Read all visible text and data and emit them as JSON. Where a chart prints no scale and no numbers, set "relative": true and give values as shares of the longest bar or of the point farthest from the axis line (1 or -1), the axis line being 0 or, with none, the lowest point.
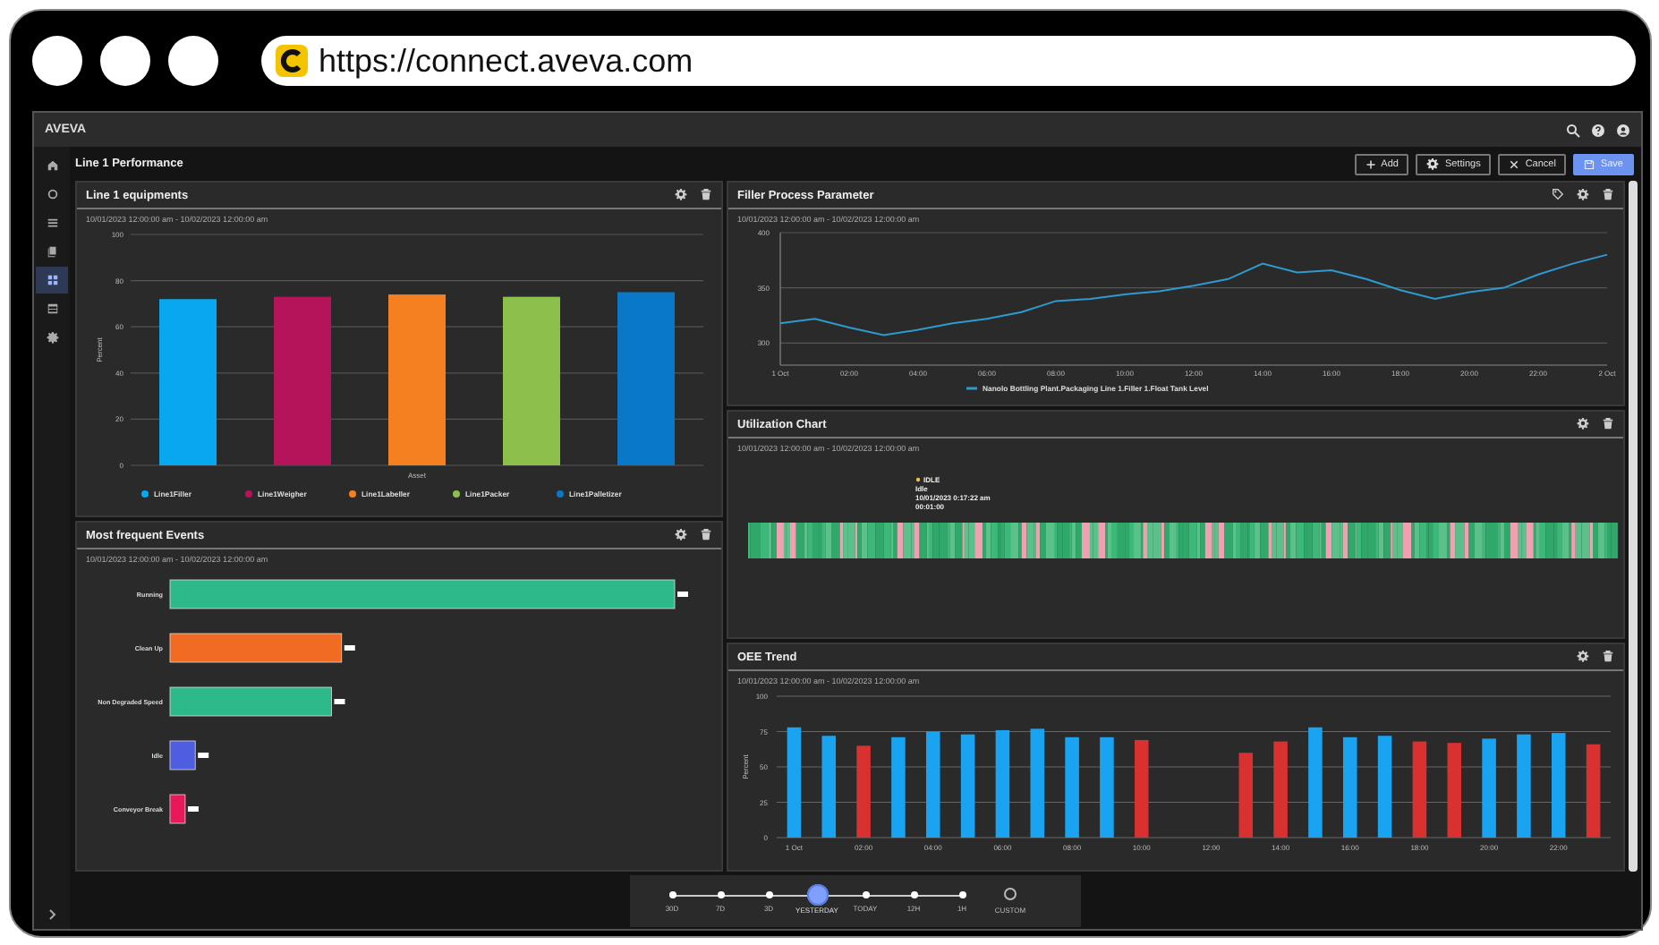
{
  "browser": {
    "url": "https://connect.aveva.com"
  },
  "app": {
    "brand": "AVEVA"
  },
  "sidebar": [
    {
      "kind": "home",
      "selected": false
    },
    {
      "kind": "gauge",
      "selected": false
    },
    {
      "kind": "list",
      "selected": false
    },
    {
      "kind": "copy",
      "selected": false
    },
    {
      "kind": "dashboard",
      "selected": true
    },
    {
      "kind": "table",
      "selected": false
    },
    {
      "kind": "settings",
      "selected": false
    }
  ],
  "page": {
    "title": "Line 1 Performance",
    "buttons": [
      {
        "kind": "add",
        "label": "Add",
        "primary": false
      },
      {
        "kind": "settings",
        "label": "Settings",
        "primary": false
      },
      {
        "kind": "cancel",
        "label": "Cancel",
        "primary": false
      },
      {
        "kind": "save",
        "label": "Save",
        "primary": true
      }
    ]
  },
  "line1_equipments": {
    "title": "Line 1 equipments",
    "date_range": "10/01/2023 12:00:00 am - 10/02/2023 12:00:00 am",
    "tag_button": false,
    "chart_data": {
      "type": "bar",
      "xlabel": "Asset",
      "ylabel": "Percent",
      "grid": true,
      "legend": "bottom",
      "ylim": [
        0,
        100
      ],
      "yticks": [
        0,
        20,
        40,
        60,
        80,
        100
      ],
      "series": [
        {
          "name": "Line1Filler",
          "color": "#08a8f0",
          "values": [
            72,
            null,
            null,
            null,
            null
          ]
        },
        {
          "name": "Line1Weigher",
          "color": "#b5145a",
          "values": [
            null,
            73,
            null,
            null,
            null
          ]
        },
        {
          "name": "Line1Labeller",
          "color": "#f4801f",
          "values": [
            null,
            null,
            74,
            null,
            null
          ]
        },
        {
          "name": "Line1Packer",
          "color": "#8cc04b",
          "values": [
            null,
            null,
            null,
            73,
            null
          ]
        },
        {
          "name": "Line1Palletizer",
          "color": "#0a78c8",
          "values": [
            null,
            null,
            null,
            null,
            75
          ]
        }
      ]
    }
  },
  "filler_process_parameter": {
    "title": "Filler Process Parameter",
    "date_range": "10/01/2023 12:00:00 am - 10/02/2023 12:00:00 am",
    "tag_button": true,
    "chart_data": {
      "type": "line",
      "x": [
        0,
        1,
        2,
        3,
        4,
        5,
        6,
        7,
        8,
        9,
        10,
        11,
        12,
        13,
        14,
        15,
        16,
        17,
        18,
        19,
        20,
        21,
        22,
        23,
        24
      ],
      "xticks": [
        {
          "value": 0,
          "label": "1 Oct"
        },
        {
          "value": 2,
          "label": "02:00"
        },
        {
          "value": 4,
          "label": "04:00"
        },
        {
          "value": 6,
          "label": "06:00"
        },
        {
          "value": 8,
          "label": "08:00"
        },
        {
          "value": 10,
          "label": "10:00"
        },
        {
          "value": 12,
          "label": "12:00"
        },
        {
          "value": 14,
          "label": "14:00"
        },
        {
          "value": 16,
          "label": "16:00"
        },
        {
          "value": 18,
          "label": "18:00"
        },
        {
          "value": 20,
          "label": "20:00"
        },
        {
          "value": 22,
          "label": "22:00"
        },
        {
          "value": 24,
          "label": "2 Oct"
        }
      ],
      "xlim": [
        0,
        24
      ],
      "ylim": [
        280,
        400
      ],
      "yticks": [
        300,
        350,
        400
      ],
      "grid": true,
      "legend": "bottom",
      "series": [
        {
          "name": "Nanolo Bottling Plant.Packaging Line 1.Filler 1.Float Tank Level",
          "color": "#2e9ad0",
          "values": [
            318,
            322,
            314,
            307,
            312,
            318,
            322,
            328,
            338,
            340,
            344,
            347,
            352,
            358,
            372,
            364,
            366,
            358,
            348,
            340,
            346,
            350,
            362,
            372,
            380
          ]
        }
      ]
    }
  },
  "utilization_chart": {
    "title": "Utilization Chart",
    "date_range": "10/01/2023 12:00:00 am - 10/02/2023 12:00:00 am",
    "tag_button": false,
    "tooltip": {
      "state": "IDLE",
      "label": "Idle",
      "time": "10/01/2023 0:17:22 am",
      "duration": "00:01:00"
    }
  },
  "most_frequent_events": {
    "title": "Most frequent Events",
    "date_range": "10/01/2023 12:00:00 am - 10/02/2023 12:00:00 am",
    "tag_button": false,
    "chart_data": {
      "type": "bar",
      "orientation": "horizontal",
      "relative": true,
      "categories": [
        "Running",
        "Clean Up",
        "Non Degraded Speed",
        "Idle",
        "Conveyor Break"
      ],
      "series": [
        {
          "color": "#2db98a",
          "values": [
            1,
            null,
            0.32,
            null,
            null
          ]
        },
        {
          "color": "#f26b22",
          "values": [
            null,
            0.34,
            null,
            null,
            null
          ]
        },
        {
          "color": "#4f5de0",
          "values": [
            null,
            null,
            null,
            0.05,
            null
          ]
        },
        {
          "color": "#e8185a",
          "values": [
            null,
            null,
            null,
            null,
            0.03
          ]
        }
      ]
    }
  },
  "oee_trend": {
    "title": "OEE Trend",
    "date_range": "10/01/2023 12:00:00 am - 10/02/2023 12:00:00 am",
    "tag_button": false,
    "chart_data": {
      "type": "bar",
      "ylabel": "Percent",
      "x": [
        0,
        1,
        2,
        3,
        4,
        5,
        6,
        7,
        8,
        9,
        10,
        11,
        12,
        13,
        14,
        15,
        16,
        17,
        18,
        19,
        20,
        21,
        22,
        23
      ],
      "xticks": [
        {
          "value": 0,
          "label": "1 Oct"
        },
        {
          "value": 2,
          "label": "02:00"
        },
        {
          "value": 4,
          "label": "04:00"
        },
        {
          "value": 6,
          "label": "06:00"
        },
        {
          "value": 8,
          "label": "08:00"
        },
        {
          "value": 10,
          "label": "10:00"
        },
        {
          "value": 12,
          "label": "12:00"
        },
        {
          "value": 14,
          "label": "14:00"
        },
        {
          "value": 16,
          "label": "16:00"
        },
        {
          "value": 18,
          "label": "18:00"
        },
        {
          "value": 20,
          "label": "20:00"
        },
        {
          "value": 22,
          "label": "22:00"
        }
      ],
      "xlim": [
        -0.5,
        23.5
      ],
      "ylim": [
        0,
        100
      ],
      "yticks": [
        0,
        25,
        50,
        75,
        100
      ],
      "grid": true,
      "series": [
        {
          "color": "#1aa3f0",
          "values": [
            78,
            72,
            null,
            71,
            75,
            73,
            76,
            77,
            71,
            71,
            null,
            null,
            null,
            null,
            null,
            78,
            71,
            72,
            null,
            null,
            70,
            73,
            74,
            null
          ]
        },
        {
          "color": "#d93030",
          "values": [
            null,
            null,
            65,
            null,
            null,
            null,
            null,
            null,
            null,
            null,
            69,
            null,
            null,
            60,
            68,
            null,
            null,
            null,
            68,
            67,
            null,
            null,
            null,
            66
          ]
        }
      ]
    }
  },
  "timeline": {
    "items": [
      {
        "kind": "preset",
        "label": "30D",
        "selected": false
      },
      {
        "kind": "preset",
        "label": "7D",
        "selected": false
      },
      {
        "kind": "preset",
        "label": "3D",
        "selected": false
      },
      {
        "kind": "preset",
        "label": "YESTERDAY",
        "selected": true
      },
      {
        "kind": "preset",
        "label": "TODAY",
        "selected": false
      },
      {
        "kind": "preset",
        "label": "12H",
        "selected": false
      },
      {
        "kind": "preset",
        "label": "1H",
        "selected": false
      },
      {
        "kind": "custom",
        "label": "CUSTOM",
        "selected": false
      }
    ]
  }
}
